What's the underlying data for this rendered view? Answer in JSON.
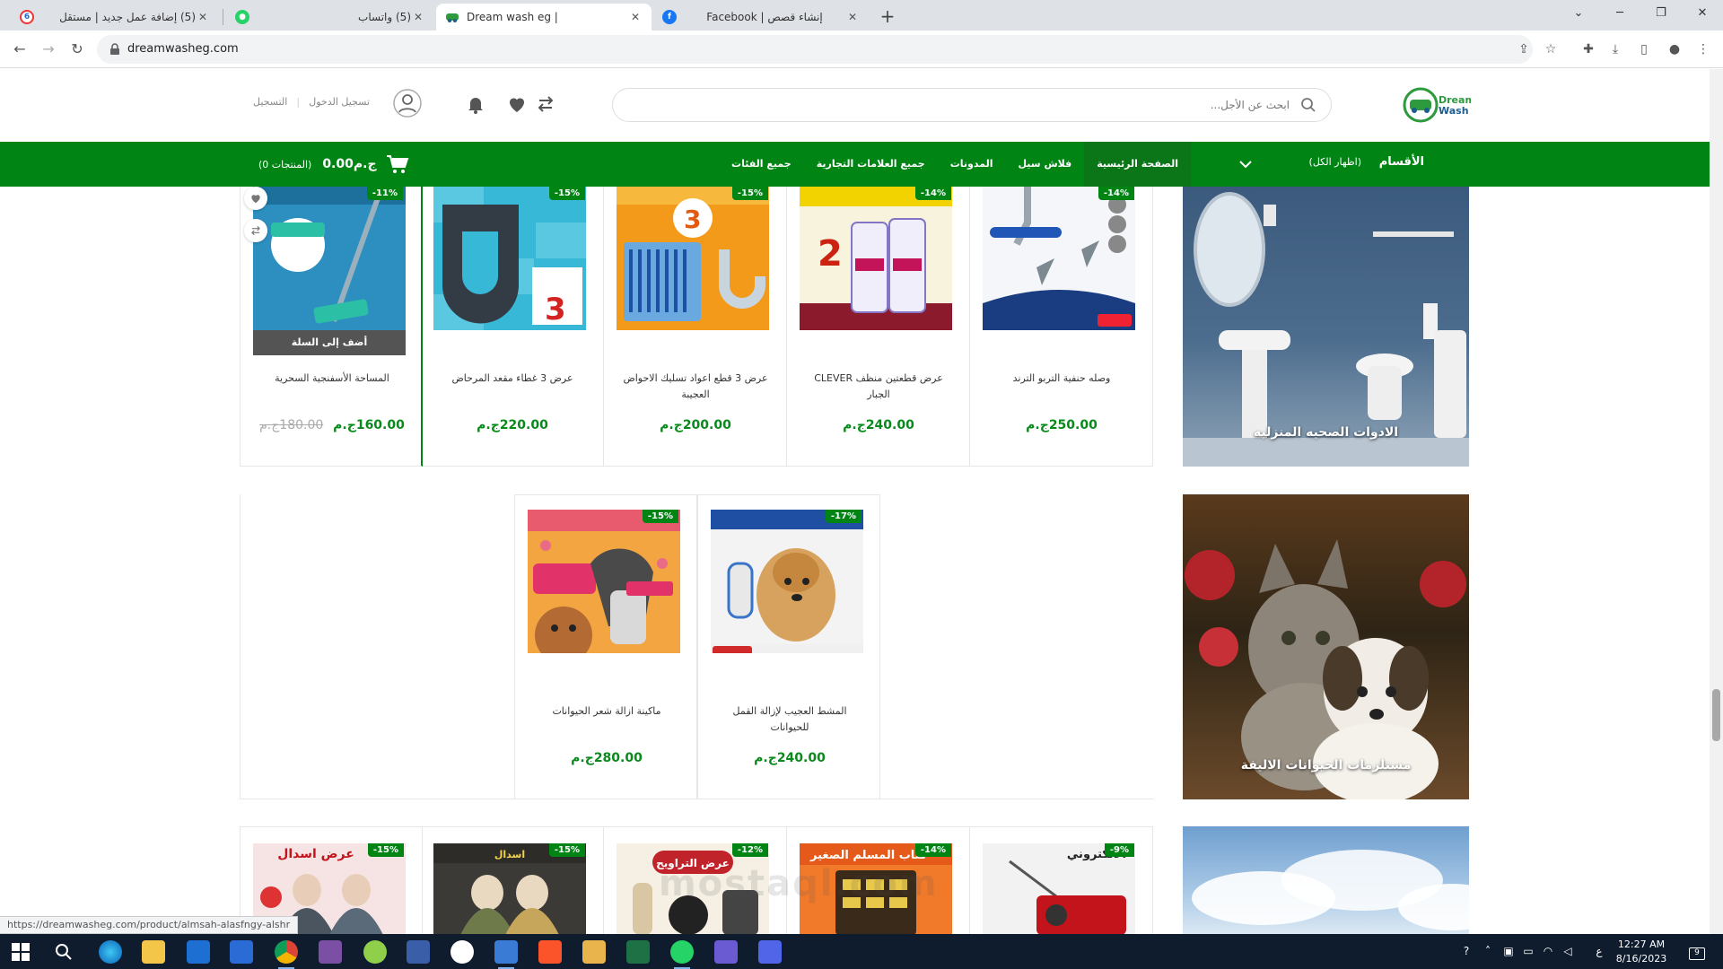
{
  "browser": {
    "tabs": [
      {
        "title": "(5) إضافة عمل جديد | مستقل",
        "favicon_color": "#ffffff",
        "favicon_text": "6",
        "active": false
      },
      {
        "title": "(5) واتساب",
        "favicon_color": "#25d366",
        "favicon_text": "",
        "active": false
      },
      {
        "title": "Dream wash eg |",
        "favicon_color": "#ffffff",
        "favicon_text": "",
        "active": true
      },
      {
        "title": "Facebook | إنشاء قصص",
        "favicon_color": "#1877f2",
        "favicon_text": "f",
        "active": false
      }
    ],
    "new_tab": "+",
    "url": "dreamwasheg.com",
    "status_url": "https://dreamwasheg.com/product/almsah-alasfngy-alshr"
  },
  "site": {
    "logo_line1": "Dream",
    "logo_line2": "Wash",
    "search_placeholder": "ابحث عن الأجل...",
    "user_links": {
      "login": "تسجيل الدخول",
      "register": "التسجيل"
    },
    "brand_color": "#008515"
  },
  "nav": {
    "categories_label": "الأقسام",
    "show_all": "(اظهار الكل)",
    "menu": [
      {
        "label": "الصفحة الرئيسية",
        "active": true
      },
      {
        "label": "فلاش سيل",
        "active": false
      },
      {
        "label": "المدونات",
        "active": false
      },
      {
        "label": "جميع العلامات التجارية",
        "active": false
      },
      {
        "label": "جميع الفئات",
        "active": false
      }
    ],
    "cart_amount": "0.00ج.م",
    "cart_count": "(0 المنتجات)"
  },
  "sections": [
    {
      "banner": "الادوات الصحيه المنزليه",
      "products": [
        {
          "name": "وصله حنفية التربو الترند",
          "price": "250.00ج.م",
          "old_price": "",
          "discount": "-14%",
          "img": "faucet"
        },
        {
          "name": "عرض قطعتين منظف CLEVER الجبار",
          "price": "240.00ج.م",
          "old_price": "",
          "discount": "-14%",
          "img": "clever"
        },
        {
          "name": "عرض 3 قطع اعواد تسليك الاحواض العجيبة",
          "price": "200.00ج.م",
          "old_price": "",
          "discount": "-15%",
          "img": "sticks"
        },
        {
          "name": "عرض 3 غطاء مقعد المرحاض",
          "price": "220.00ج.م",
          "old_price": "",
          "discount": "-15%",
          "img": "seat"
        },
        {
          "name": "المساحة الأسفنجية السحرية",
          "price": "160.00ج.م",
          "old_price": "180.00ج.م",
          "discount": "-11%",
          "img": "mop"
        }
      ],
      "add_to_cart": "أضف إلى السلة"
    },
    {
      "banner": "مستلزمات الحيوانات الاليفة",
      "products": [
        {
          "name": "المشط العجيب لإزالة القمل للحيوانات",
          "price": "240.00ج.م",
          "old_price": "",
          "discount": "-17%",
          "img": "dog"
        },
        {
          "name": "ماكينة ازالة شعر الحيوانات",
          "price": "280.00ج.م",
          "old_price": "",
          "discount": "-15%",
          "img": "vacuum"
        }
      ]
    },
    {
      "banner": "",
      "products": [
        {
          "name": "",
          "price": "",
          "old_price": "",
          "discount": "-9%",
          "img": "radio",
          "img_text": "الالكتروني"
        },
        {
          "name": "",
          "price": "",
          "old_price": "",
          "discount": "-14%",
          "img": "book",
          "img_text": "كتاب المسلم الصغير"
        },
        {
          "name": "",
          "price": "",
          "old_price": "",
          "discount": "-12%",
          "img": "trimmer",
          "img_text": "عرض التراويح"
        },
        {
          "name": "",
          "price": "",
          "old_price": "",
          "discount": "-15%",
          "img": "robe2",
          "img_text": "اسدال"
        },
        {
          "name": "",
          "price": "",
          "old_price": "",
          "discount": "-15%",
          "img": "robe",
          "img_text": "عرض اسدال"
        }
      ]
    }
  ],
  "watermark": "mostaql.com",
  "taskbar": {
    "time": "12:27 AM",
    "date": "8/16/2023",
    "lang": "ع",
    "notifications": "9"
  }
}
